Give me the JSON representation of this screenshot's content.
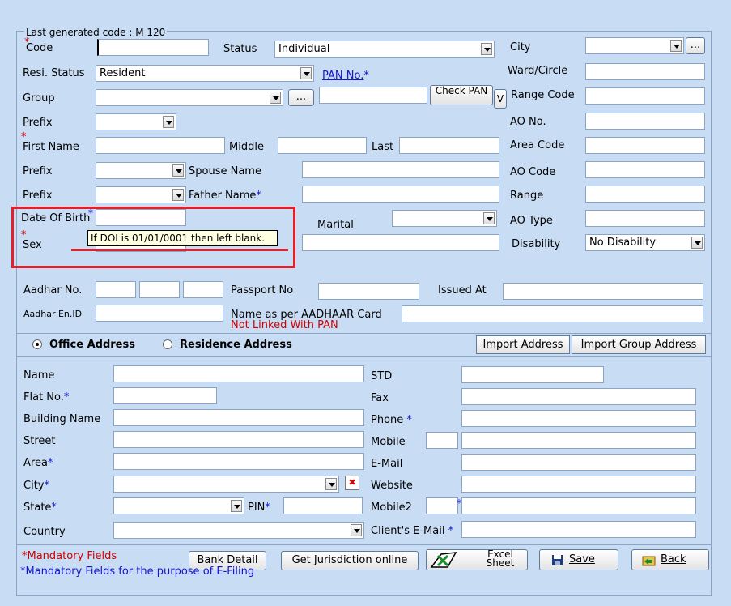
{
  "header": {
    "last_code": "Last generated code : M 120"
  },
  "labels": {
    "code": "Code",
    "status": "Status",
    "city": "City",
    "resi_status": "Resi. Status",
    "pan_no": "PAN No.",
    "ward_circle": "Ward/Circle",
    "group": "Group",
    "check_pan": "Check PAN",
    "v": "V",
    "range_code": "Range Code",
    "prefix": "Prefix",
    "ao_no": "AO No.",
    "first_name": "First Name",
    "middle": "Middle",
    "last": "Last",
    "area_code": "Area Code",
    "spouse_name": "Spouse Name",
    "ao_code": "AO Code",
    "father_name": "Father Name",
    "range": "Range",
    "dob": "Date Of Birth",
    "marital": "Marital",
    "ao_type": "AO Type",
    "sex": "Sex",
    "disability": "Disability",
    "aadhar_no": "Aadhar No.",
    "passport_no": "Passport No",
    "issued_at": "Issued At",
    "aadhar_en_id": "Aadhar En.ID",
    "name_as_aadhaar": "Name as per AADHAAR Card",
    "not_linked": "Not Linked With PAN",
    "ellipsis": "..."
  },
  "values": {
    "status": "Individual",
    "resi_status": "Resident",
    "disability": "No Disability"
  },
  "tooltip": "If DOI is 01/01/0001 then left blank.",
  "address": {
    "office_tab": "Office Address",
    "residence_tab": "Residence Address",
    "import_address": "Import Address",
    "import_group_address": "Import Group Address",
    "name": "Name",
    "flat_no": "Flat No.",
    "building_name": "Building Name",
    "street": "Street",
    "area": "Area",
    "city": "City",
    "state": "State",
    "pin": "PIN",
    "country": "Country",
    "std": "STD",
    "fax": "Fax",
    "phone": "Phone",
    "mobile": "Mobile",
    "email": "E-Mail",
    "website": "Website",
    "mobile2": "Mobile2",
    "clients_email": "Client's E-Mail"
  },
  "footer": {
    "mandatory": "*Mandatory Fields",
    "mandatory_efiling": "*Mandatory Fields for the purpose of E-Filing",
    "bank_detail": "Bank Detail",
    "get_jurisdiction": "Get Jurisdiction online",
    "excel_sheet": "Excel Sheet",
    "save": "Save",
    "back": "Back"
  },
  "colors": {
    "background": "#c8dcf3",
    "required_star": "#1414d4",
    "warning_red": "#d40000",
    "highlight_box": "#e0202a"
  }
}
